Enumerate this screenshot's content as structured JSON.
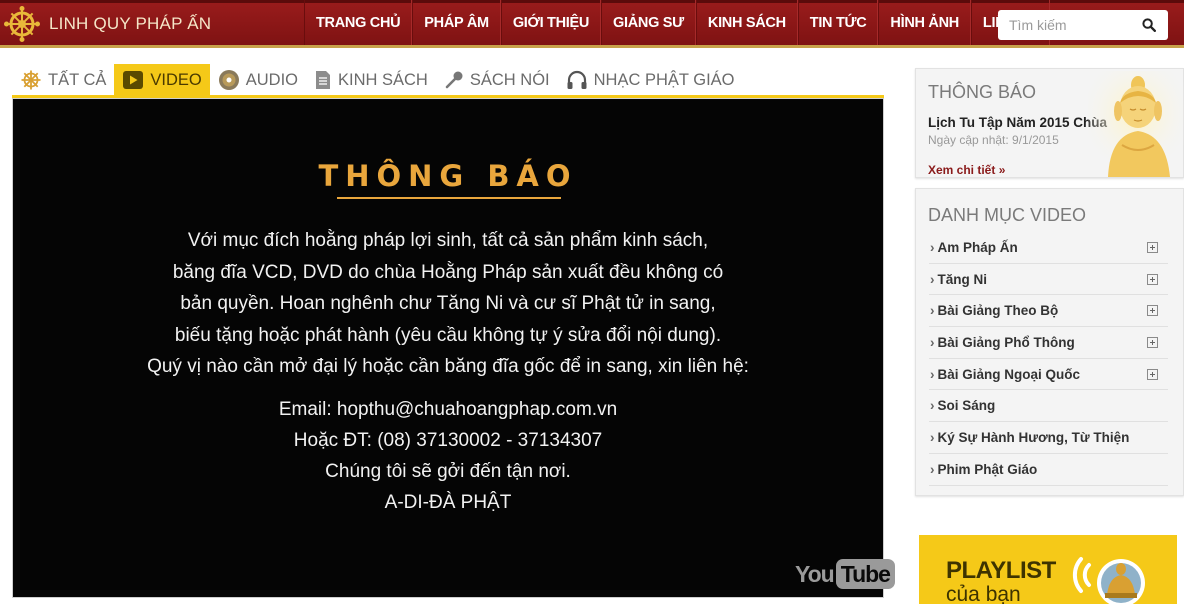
{
  "header": {
    "site_title": "LINH QUY PHÁP ẤN",
    "nav": [
      "TRANG CHỦ",
      "PHÁP ÂM",
      "GIỚI THIỆU",
      "GIẢNG SƯ",
      "KINH SÁCH",
      "TIN TỨC",
      "HÌNH ẢNH",
      "LIÊN HỆ"
    ],
    "search_placeholder": "Tìm kiếm"
  },
  "tabs": [
    {
      "label": "TẤT CẢ",
      "icon": "dharma-wheel-icon",
      "active": false
    },
    {
      "label": "VIDEO",
      "icon": "play-icon",
      "active": true
    },
    {
      "label": "AUDIO",
      "icon": "disc-icon",
      "active": false
    },
    {
      "label": "KINH SÁCH",
      "icon": "document-icon",
      "active": false
    },
    {
      "label": "SÁCH NÓI",
      "icon": "microphone-icon",
      "active": false
    },
    {
      "label": "NHẠC PHẬT GIÁO",
      "icon": "headphones-icon",
      "active": false
    }
  ],
  "video": {
    "heading": "THÔNG BÁO",
    "body_lines": [
      "Với mục đích hoằng pháp lợi sinh, tất cả sản phẩm kinh sách,",
      "băng đĩa VCD, DVD do chùa Hoằng Pháp sản xuất đều không có",
      "bản quyền. Hoan nghênh chư Tăng Ni và cư sĩ Phật tử in sang,",
      "biếu tặng hoặc phát hành (yêu cầu không tự ý sửa đổi nội dung).",
      "Quý vị nào cần mở đại lý hoặc cần băng đĩa gốc để in sang, xin liên hệ:"
    ],
    "contact_lines": [
      "Email: hopthu@chuahoangphap.com.vn",
      "Hoặc ĐT: (08) 37130002 - 37134307",
      "Chúng tôi sẽ gởi đến tận nơi.",
      "A-DI-ĐÀ PHẬT"
    ],
    "logo_you": "You",
    "logo_tube": "Tube"
  },
  "announcement": {
    "title": "THÔNG BÁO",
    "item_title": "Lịch Tu Tập Năm 2015 Chùa",
    "date": "Ngày cập nhật: 9/1/2015",
    "more": "Xem chi tiết »"
  },
  "categories": {
    "title": "DANH MỤC VIDEO",
    "items": [
      {
        "label": "Am Pháp Ấn",
        "expandable": true
      },
      {
        "label": "Tăng Ni",
        "expandable": true
      },
      {
        "label": "Bài Giảng Theo Bộ",
        "expandable": true
      },
      {
        "label": "Bài Giảng Phổ Thông",
        "expandable": true
      },
      {
        "label": "Bài Giảng Ngoại Quốc",
        "expandable": true
      },
      {
        "label": "Soi Sáng",
        "expandable": false
      },
      {
        "label": "Ký Sự Hành Hương, Từ Thiện",
        "expandable": false
      },
      {
        "label": "Phim Phật Giáo",
        "expandable": false
      }
    ]
  },
  "playlist": {
    "title": "PLAYLIST",
    "subtitle": "của bạn"
  },
  "colors": {
    "header_red": "#8c1717",
    "accent_yellow": "#f5c918",
    "heading_gold": "#e9a63c"
  }
}
